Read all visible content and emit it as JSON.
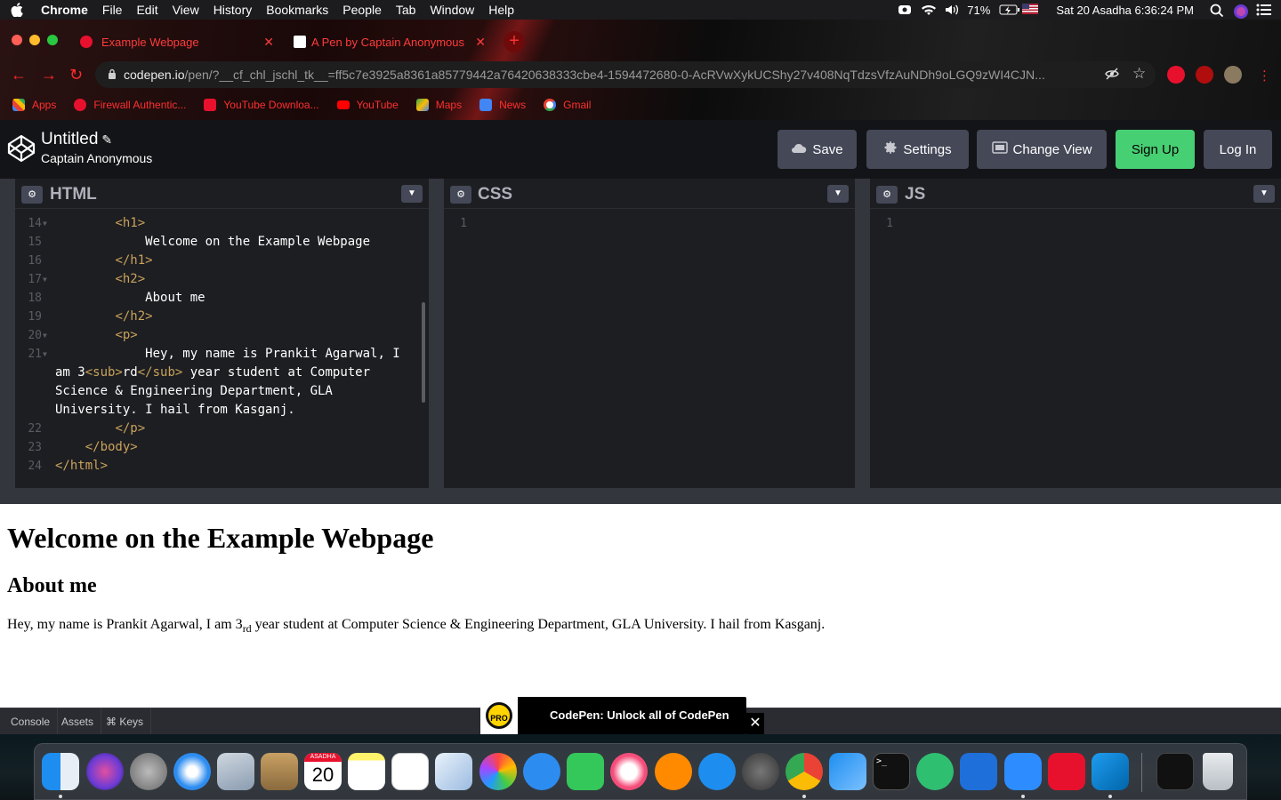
{
  "menubar": {
    "app": "Chrome",
    "items": [
      "File",
      "Edit",
      "View",
      "History",
      "Bookmarks",
      "People",
      "Tab",
      "Window",
      "Help"
    ],
    "battery": "71%",
    "datetime": "Sat 20 Asadha  6:36:24 PM"
  },
  "browser": {
    "tabs": [
      {
        "title": "Example Webpage",
        "active": true
      },
      {
        "title": "A Pen by Captain Anonymous",
        "active": false
      }
    ],
    "url_host": "codepen.io",
    "url_path": "/pen/?__cf_chl_jschl_tk__=ff5c7e3925a8361a85779442a76420638333cbe4-1594472680-0-AcRVwXykUCShy27v408NqTdzsVfzAuNDh9oLGQ9zWI4CJN...",
    "bookmarks": [
      "Apps",
      "Firewall Authentic...",
      "YouTube Downloa...",
      "YouTube",
      "Maps",
      "News",
      "Gmail"
    ],
    "accent": "#ff2f2f"
  },
  "codepen": {
    "title": "Untitled",
    "author": "Captain Anonymous",
    "buttons": {
      "save": "Save",
      "settings": "Settings",
      "change_view": "Change View",
      "signup": "Sign Up",
      "login": "Log In"
    },
    "panes": {
      "html": "HTML",
      "css": "CSS",
      "js": "JS"
    },
    "empty_line_number": "1",
    "code_lines": [
      {
        "n": "14",
        "fold": true,
        "indent": "        ",
        "parts": [
          {
            "t": "<h1>",
            "tag": true
          }
        ]
      },
      {
        "n": "15",
        "fold": false,
        "indent": "            ",
        "parts": [
          {
            "t": "Welcome on the Example Webpage",
            "tag": false
          }
        ]
      },
      {
        "n": "16",
        "fold": false,
        "indent": "        ",
        "parts": [
          {
            "t": "</h1>",
            "tag": true
          }
        ]
      },
      {
        "n": "17",
        "fold": true,
        "indent": "        ",
        "parts": [
          {
            "t": "<h2>",
            "tag": true
          }
        ]
      },
      {
        "n": "18",
        "fold": false,
        "indent": "            ",
        "parts": [
          {
            "t": "About me",
            "tag": false
          }
        ]
      },
      {
        "n": "19",
        "fold": false,
        "indent": "        ",
        "parts": [
          {
            "t": "</h2>",
            "tag": true
          }
        ]
      },
      {
        "n": "20",
        "fold": true,
        "indent": "        ",
        "parts": [
          {
            "t": "<p>",
            "tag": true
          }
        ]
      },
      {
        "n": "21",
        "fold": true,
        "indent": "            ",
        "parts": [
          {
            "t": "Hey, my name is Prankit Agarwal, I",
            "tag": false
          }
        ]
      },
      {
        "n": "",
        "fold": false,
        "indent": "",
        "parts": [
          {
            "t": "am 3",
            "tag": false
          },
          {
            "t": "<sub>",
            "tag": true
          },
          {
            "t": "rd",
            "tag": false
          },
          {
            "t": "</sub>",
            "tag": true
          },
          {
            "t": " year student at Computer",
            "tag": false
          }
        ]
      },
      {
        "n": "",
        "fold": false,
        "indent": "",
        "parts": [
          {
            "t": "Science & Engineering Department, GLA",
            "tag": false
          }
        ]
      },
      {
        "n": "",
        "fold": false,
        "indent": "",
        "parts": [
          {
            "t": "University. I hail from Kasganj.",
            "tag": false
          }
        ]
      },
      {
        "n": "22",
        "fold": false,
        "indent": "        ",
        "parts": [
          {
            "t": "</p>",
            "tag": true
          }
        ]
      },
      {
        "n": "23",
        "fold": false,
        "indent": "    ",
        "parts": [
          {
            "t": "</body>",
            "tag": true
          }
        ]
      },
      {
        "n": "24",
        "fold": false,
        "indent": "",
        "parts": [
          {
            "t": "</html>",
            "tag": true
          }
        ]
      }
    ],
    "preview": {
      "h1": "Welcome on the Example Webpage",
      "h2": "About me",
      "p_before": "Hey, my name is Prankit Agarwal, I am 3",
      "p_sub": "rd",
      "p_after": " year student at Computer Science & Engineering Department, GLA University. I hail from Kasganj."
    },
    "footer": {
      "console": "Console",
      "assets": "Assets",
      "keys": "⌘ Keys"
    },
    "promo": {
      "badge": "PRO",
      "text": "CodePen: Unlock all of CodePen"
    }
  },
  "dock": {
    "calendar_month": "ASADHA",
    "calendar_day": "20"
  }
}
